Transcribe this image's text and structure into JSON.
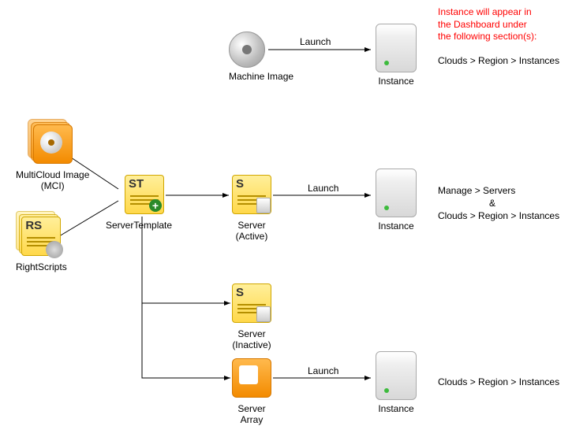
{
  "notes": {
    "header": "Instance will appear in\nthe Dashboard under\nthe following section(s):"
  },
  "nodes": {
    "machine_image": "Machine Image",
    "mci": "MultiCloud Image\n(MCI)",
    "rightscripts": "RightScripts",
    "servertemplate": "ServerTemplate",
    "server_active": "Server\n(Active)",
    "server_inactive": "Server\n(Inactive)",
    "server_array": "Server\nArray",
    "instance": "Instance"
  },
  "icon_text": {
    "mci_badge": "",
    "rightscripts_badge": "RS",
    "servertemplate_badge": "ST",
    "server_badge": "S"
  },
  "edges": {
    "launch": "Launch"
  },
  "paths": {
    "clouds_instances": "Clouds > Region > Instances",
    "servers_line1": "Manage > Servers",
    "servers_amp": "&",
    "servers_line2": "Clouds > Region > Instances",
    "array": "Clouds > Region > Instances"
  }
}
